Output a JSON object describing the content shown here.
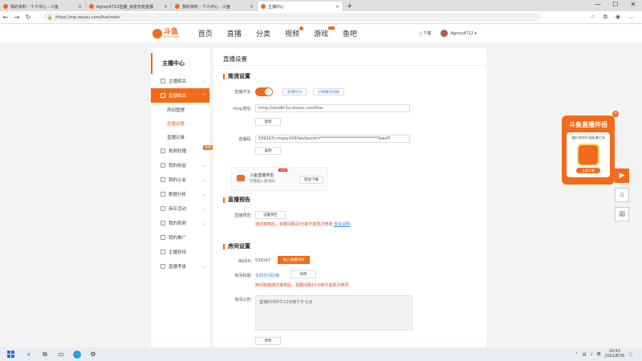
{
  "browser": {
    "tabs": [
      {
        "title": "我的资料 - 个人中心 - 斗鱼",
        "active": false
      },
      {
        "title": "Agnoy4712直播_余能无底直播",
        "active": false
      },
      {
        "title": "我的资料 - 个人中心 - 斗鱼",
        "active": false
      },
      {
        "title": "主播中心",
        "active": true
      }
    ],
    "new_tab": "+",
    "url": "https://mp.douyu.com/live/main",
    "window_controls": [
      "—",
      "☐",
      "✕"
    ]
  },
  "site": {
    "logo_text": "斗鱼",
    "logo_sub": "DOUYU.COM",
    "nav": [
      "首页",
      "直播",
      "分类",
      "视频",
      "游戏",
      "鱼吧"
    ],
    "download": "下载",
    "username": "Agnoy4712"
  },
  "sidebar": {
    "title": "主播中心",
    "items": [
      {
        "label": "主播相关",
        "type": "group"
      },
      {
        "label": "直播相关",
        "type": "group-active"
      },
      {
        "label": "房间管理",
        "type": "sub"
      },
      {
        "label": "直播设置",
        "type": "sub-current"
      },
      {
        "label": "直播记录",
        "type": "sub"
      },
      {
        "label": "视频轮播",
        "type": "item",
        "badge": "免费"
      },
      {
        "label": "我的收益",
        "type": "group"
      },
      {
        "label": "我的公会",
        "type": "group"
      },
      {
        "label": "数据分析",
        "type": "group"
      },
      {
        "label": "商业活动",
        "type": "group"
      },
      {
        "label": "我的视频",
        "type": "group"
      },
      {
        "label": "我的推广",
        "type": "item"
      },
      {
        "label": "主播扶持",
        "type": "item"
      },
      {
        "label": "直播考级",
        "type": "group"
      }
    ]
  },
  "main": {
    "page_title": "直播设置",
    "push": {
      "section": "推流设置",
      "switch_label": "直播开关:",
      "btn1": "直播时间",
      "btn2": "切换推流线路",
      "rtmp_label": "rtmp地址:",
      "rtmp_value": "rtmp://sendtc1a.douyu.com/live",
      "copy1": "复制",
      "code_label": "直播码:",
      "code_value": "539167rcmqoy2V9?wsSecret=*****************************&wsTi",
      "copy2": "复制"
    },
    "promo": {
      "title": "斗鱼直播伴侣",
      "subtitle": "仅需插入推流码",
      "new": "new",
      "button": "前往下载"
    },
    "preview": {
      "section": "直播预告",
      "label": "直播预告:",
      "button": "设置预告",
      "warning": "通过审核后，需要间隔10分钟才能再次修改",
      "link": "查看说明"
    },
    "room": {
      "section": "房间设置",
      "id_label": "房间ID:",
      "id_value": "539167",
      "enter_button": "进入直播间间",
      "title_label": "房间标题:",
      "title_value": "永劫无间回播",
      "edit_button": "修改",
      "title_warning": "房间标题通过审核后，需要间隔10分钟才能再次修改",
      "notice_label": "房间公告:",
      "notice_value": "直播时间中午12点到下午七点",
      "notice_edit": "修改"
    }
  },
  "ad": {
    "title": "斗鱼直播伴侣",
    "desc": "最好用的PC端直播工具",
    "download": "立即下载",
    "close": "×"
  },
  "taskbar": {
    "time": "20:53",
    "date": "2021/8/30",
    "lang": "英"
  },
  "colors": {
    "accent": "#f26a1b",
    "link": "#3a8ee6",
    "warning": "#e5421b"
  }
}
